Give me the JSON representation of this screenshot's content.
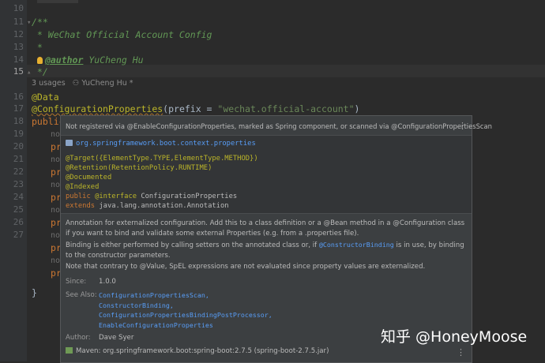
{
  "editor": {
    "line_numbers": [
      "10",
      "11",
      "12",
      "13",
      "14",
      "15",
      "16",
      "17",
      "18",
      "19",
      "20",
      "21",
      "22",
      "23",
      "24",
      "25",
      "26",
      "27"
    ],
    "current_line": "15",
    "doc_open": "/**",
    "doc_title": " * WeChat Official Account Config",
    "doc_star": " *",
    "doc_author_tag": "@author",
    "doc_author_name": " YuCheng Hu",
    "doc_close": " */",
    "inlay_usages": "3 usages",
    "inlay_author": "YuCheng Hu *",
    "ann_data": "@Data",
    "ann_config": "@ConfigurationProperties",
    "ann_paren_open": "(prefix = ",
    "ann_prefix_value": "\"wechat.official-account\"",
    "ann_paren_close": ")",
    "class_decl": "public",
    "field_no": "no",
    "field_pr": "pr",
    "closing_brace": "}"
  },
  "popup": {
    "header_text": "Not registered via @EnableConfigurationProperties, marked as Spring component, or scanned via @ConfigurationPropertiesScan",
    "package": "org.springframework.boot.context.properties",
    "sig_target": "@Target({ElementType.TYPE,ElementType.METHOD})",
    "sig_retention": "@Retention(RetentionPolicy.RUNTIME)",
    "sig_documented": "@Documented",
    "sig_indexed": "@Indexed",
    "sig_public": "public ",
    "sig_interface": "@interface",
    "sig_name": " ConfigurationProperties",
    "sig_extends": "extends",
    "sig_extends_type": " java.lang.annotation.Annotation",
    "desc_p1": "Annotation for externalized configuration. Add this to a class definition or a @Bean method in a @Configuration class if you want to bind and validate some external Properties (e.g. from a .properties file).",
    "desc_p2_a": "Binding is either performed by calling setters on the annotated class or, if ",
    "desc_p2_link": "@ConstructorBinding",
    "desc_p2_b": " is in use, by binding to the constructor parameters.",
    "desc_p3": "Note that contrary to @Value, SpEL expressions are not evaluated since property values are externalized.",
    "since_label": "Since:",
    "since_value": "1.0.0",
    "see_also_label": "See Also:",
    "see_also": [
      "ConfigurationPropertiesScan,",
      "ConstructorBinding,",
      "ConfigurationPropertiesBindingPostProcessor,",
      "EnableConfigurationProperties"
    ],
    "author_label": "Author:",
    "author_value": "Dave Syer",
    "maven_text": "Maven: org.springframework.boot:spring-boot:2.7.5 (spring-boot-2.7.5.jar)",
    "menu_icon": "vertical-ellipsis-icon"
  },
  "watermark": "知乎 @HoneyMoose"
}
